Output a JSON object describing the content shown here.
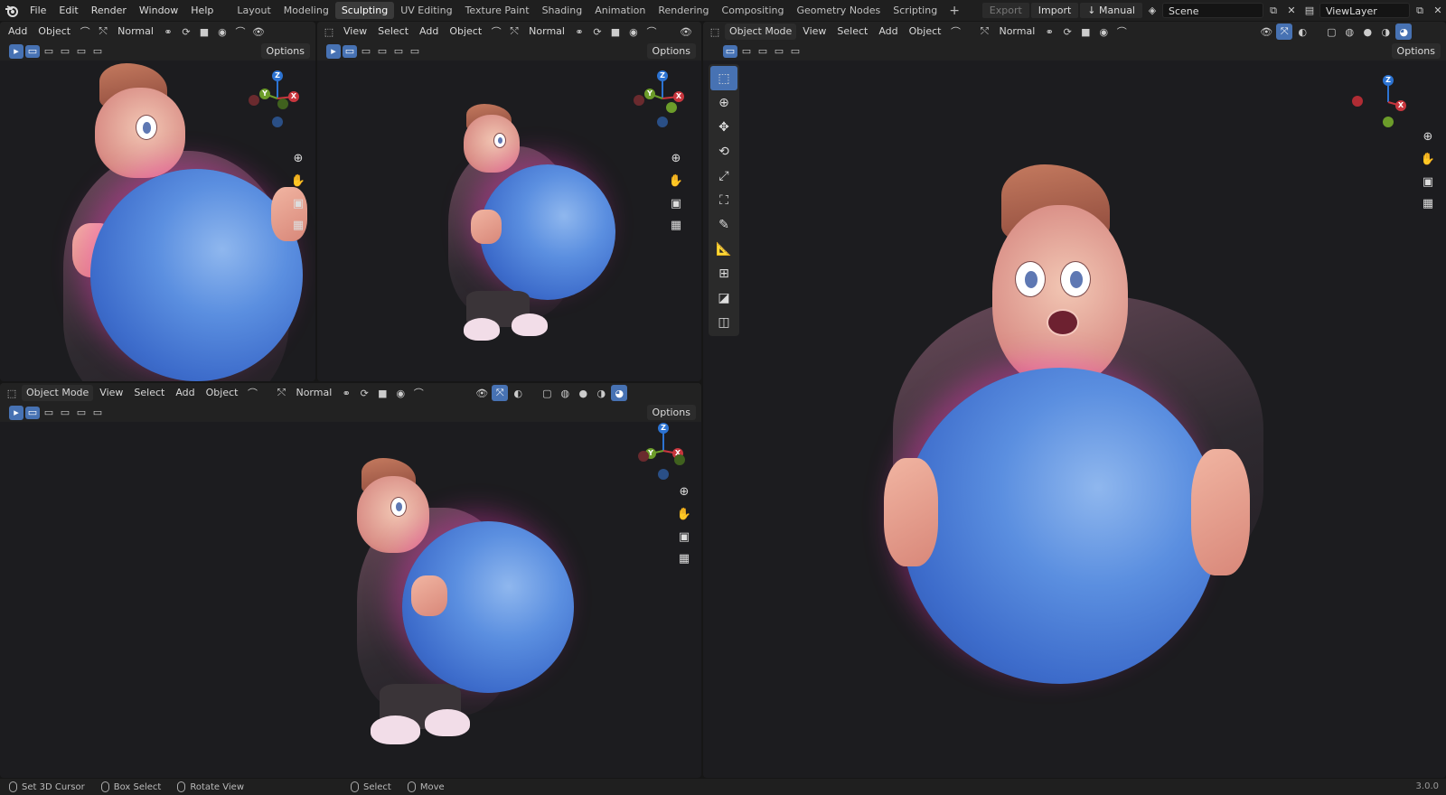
{
  "menu": [
    "File",
    "Edit",
    "Render",
    "Window",
    "Help"
  ],
  "workspaces": [
    "Layout",
    "Modeling",
    "Sculpting",
    "UV Editing",
    "Texture Paint",
    "Shading",
    "Animation",
    "Rendering",
    "Compositing",
    "Geometry Nodes",
    "Scripting"
  ],
  "active_workspace": "Sculpting",
  "topbar_right": {
    "export": "Export",
    "import": "Import",
    "manual": "Manual",
    "scene": "Scene",
    "view_layer": "ViewLayer"
  },
  "viewports": {
    "top_left": {
      "menus": [
        "Add",
        "Object"
      ],
      "orientation": "Normal",
      "options": "Options"
    },
    "top_middle": {
      "menus": [
        "View",
        "Select",
        "Add",
        "Object"
      ],
      "orientation": "Normal",
      "options": "Options"
    },
    "bottom_left": {
      "mode": "Object Mode",
      "menus": [
        "View",
        "Select",
        "Add",
        "Object"
      ],
      "orientation": "Normal",
      "options": "Options"
    },
    "right": {
      "mode": "Object Mode",
      "menus": [
        "View",
        "Select",
        "Add",
        "Object"
      ],
      "orientation": "Normal",
      "options": "Options"
    }
  },
  "gizmo": {
    "z": "Z",
    "y": "Y",
    "x": "X"
  },
  "colors": {
    "x_axis": "#c8363e",
    "y_axis": "#6c9c2a",
    "z_axis": "#2c73d2",
    "accent": "#4772b3"
  },
  "status": {
    "cursor": "Set 3D Cursor",
    "box": "Box Select",
    "rotate": "Rotate View",
    "select": "Select",
    "move": "Move",
    "version": "3.0.0"
  }
}
